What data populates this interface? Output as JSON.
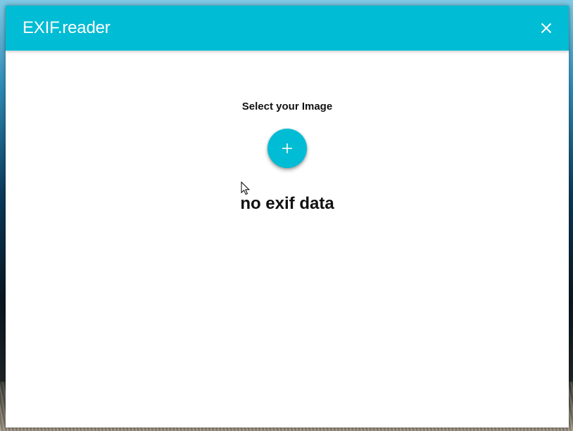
{
  "app": {
    "title": "EXIF.reader"
  },
  "main": {
    "select_label": "Select your Image",
    "status": "no exif data"
  },
  "icons": {
    "close": "close-icon",
    "add": "plus-icon",
    "cursor": "mouse-pointer-icon"
  },
  "colors": {
    "accent": "#00bcd4",
    "title_text": "#ffffff",
    "body_text": "#111111",
    "background": "#ffffff"
  }
}
